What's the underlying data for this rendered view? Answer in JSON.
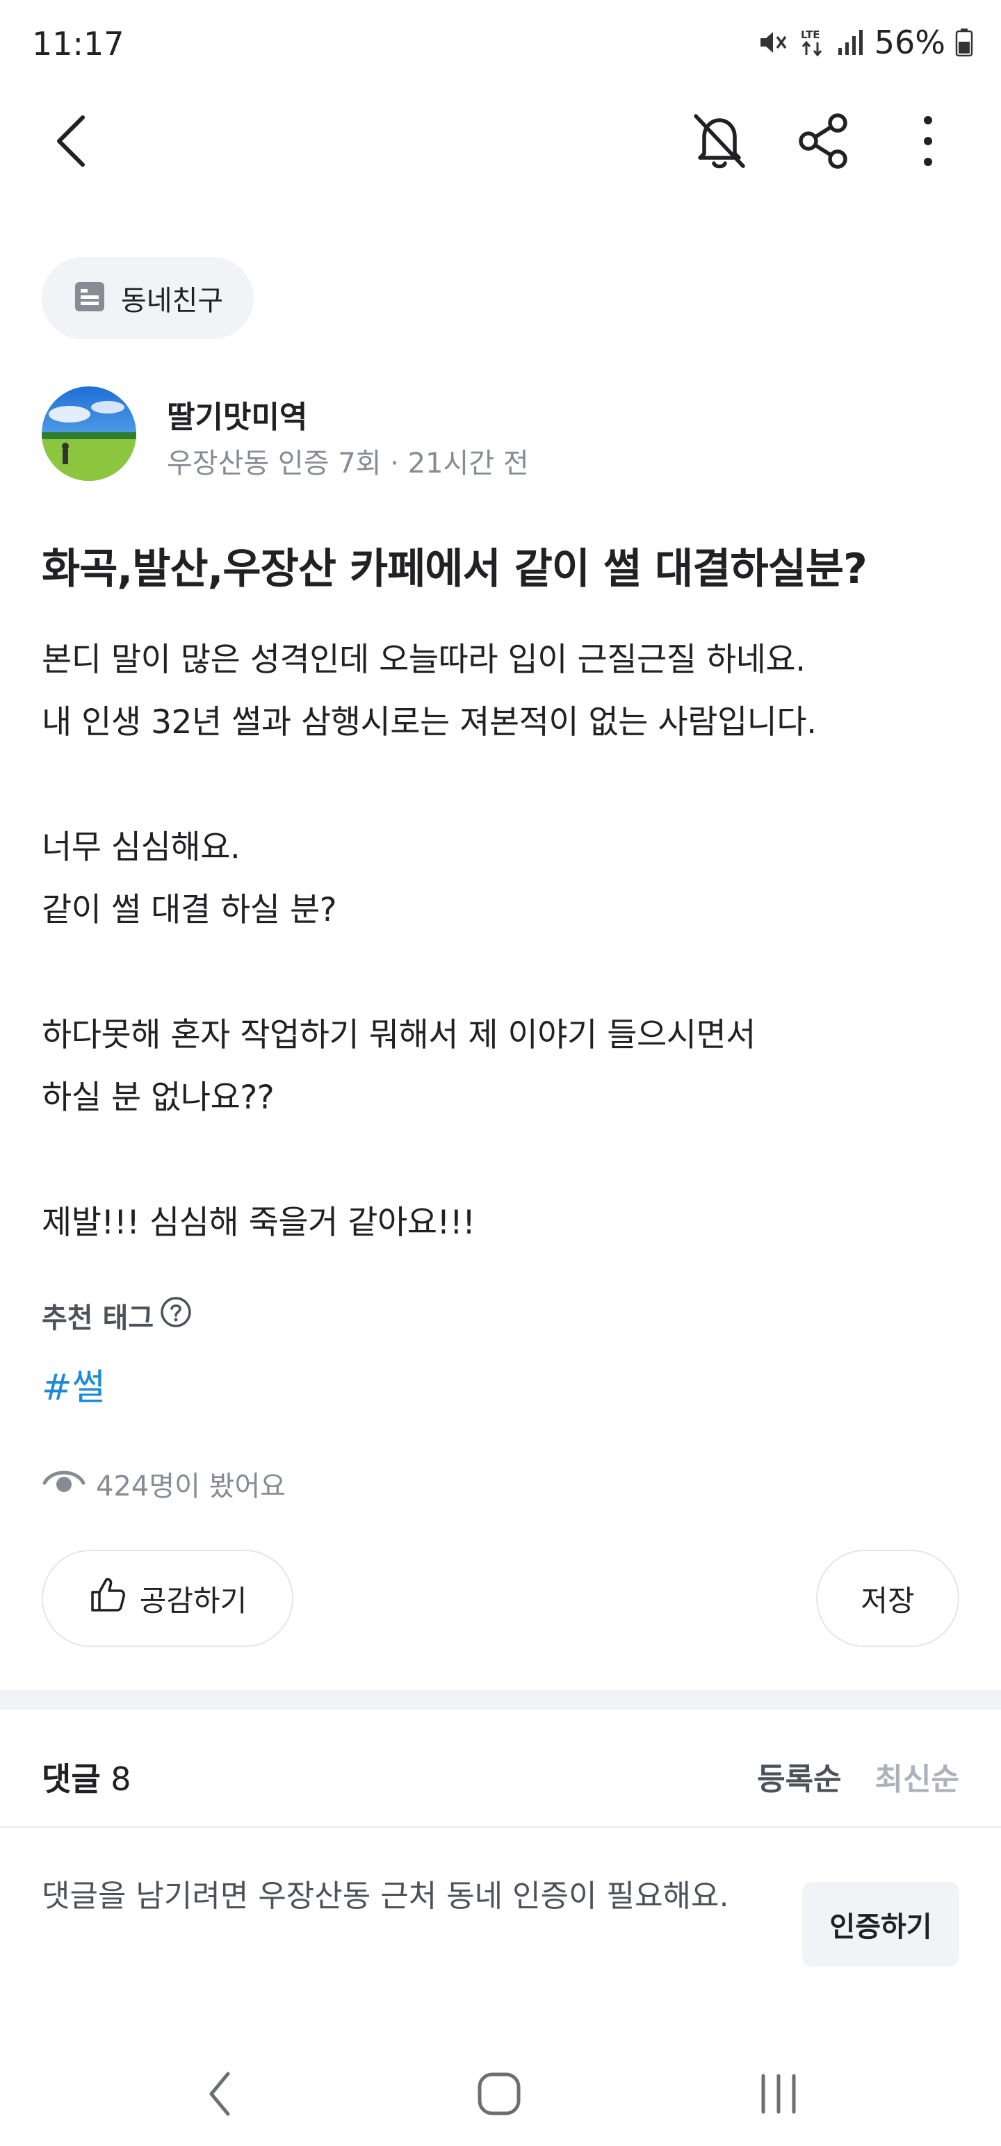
{
  "status_bar": {
    "time": "11:17",
    "battery": "56%",
    "network": "LTE"
  },
  "app_bar": {
    "icons": [
      "back-arrow-icon",
      "notification-off-icon",
      "share-icon",
      "more-vertical-icon"
    ]
  },
  "post": {
    "category": "동네친구",
    "author": {
      "name": "딸기맛미역",
      "meta": "우장산동 인증 7회 · 21시간 전"
    },
    "title": "화곡,발산,우장산 카페에서 같이 썰 대결하실분?",
    "body": "본디 말이 많은 성격인데 오늘따라 입이 근질근질 하네요.\n내 인생 32년 썰과 삼행시로는 져본적이 없는 사람입니다.\n\n너무 심심해요.\n같이 썰 대결 하실 분?\n\n하다못해 혼자 작업하기 뭐해서 제 이야기 들으시면서\n하실 분 없나요??\n\n제발!!! 심심해 죽을거 같아요!!!",
    "tags_heading": "추천 태그",
    "tags": [
      "#썰"
    ],
    "views": "424명이 봤어요",
    "like_label": "공감하기",
    "save_label": "저장"
  },
  "comments": {
    "title": "댓글",
    "count": "8",
    "sort_registered": "등록순",
    "sort_latest": "최신순",
    "notice": "댓글을 남기려면 우장산동 근처 동네 인증이 필요해요.",
    "verify_label": "인증하기"
  },
  "colors": {
    "text": "#212124",
    "secondary_text": "#868b94",
    "tag_blue": "#1c8ad8",
    "chip_bg": "#f2f3f6",
    "border": "#e3e5e8"
  }
}
